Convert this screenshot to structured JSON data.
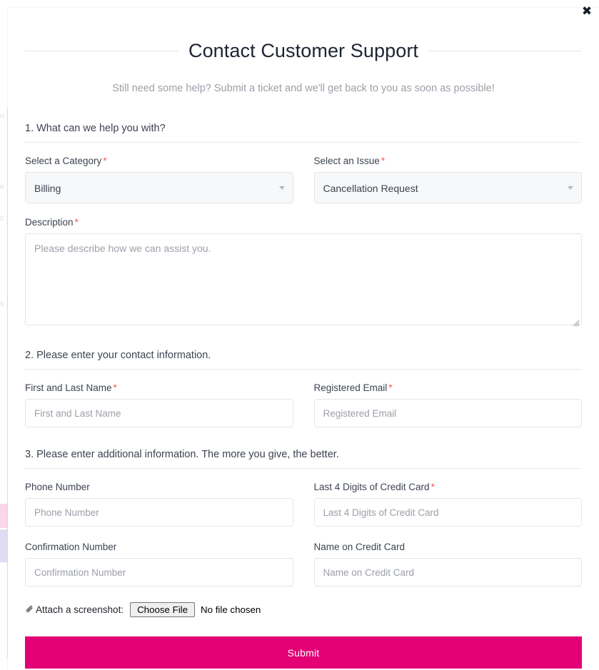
{
  "modal": {
    "close_label": "✖",
    "title": "Contact Customer Support",
    "subtitle": "Still need some help? Submit a ticket and we'll get back to you as soon as possible!"
  },
  "accent_color": "#e20074",
  "required_marker": "*",
  "sections": [
    {
      "heading": "1. What can we help you with?",
      "fields": {
        "category_label": "Select a Category",
        "category_value": "Billing",
        "issue_label": "Select an Issue",
        "issue_value": "Cancellation Request",
        "description_label": "Description",
        "description_placeholder": "Please describe how we can assist you.",
        "description_value": ""
      }
    },
    {
      "heading": "2. Please enter your contact information.",
      "fields": {
        "name_label": "First and Last Name",
        "name_placeholder": "First and Last Name",
        "name_value": "",
        "email_label": "Registered Email",
        "email_placeholder": "Registered Email",
        "email_value": ""
      }
    },
    {
      "heading": "3. Please enter additional information. The more you give, the better.",
      "fields": {
        "phone_label": "Phone Number",
        "phone_placeholder": "Phone Number",
        "phone_value": "",
        "card4_label": "Last 4 Digits of Credit Card",
        "card4_placeholder": "Last 4 Digits of Credit Card",
        "card4_value": "",
        "confirmation_label": "Confirmation Number",
        "confirmation_placeholder": "Confirmation Number",
        "confirmation_value": "",
        "cardname_label": "Name on Credit Card",
        "cardname_placeholder": "Name on Credit Card",
        "cardname_value": ""
      }
    }
  ],
  "attach": {
    "icon": "✎",
    "label": "Attach a screenshot:",
    "button_label": "Choose File",
    "status": "No file chosen"
  },
  "submit": {
    "label": "Submit"
  }
}
